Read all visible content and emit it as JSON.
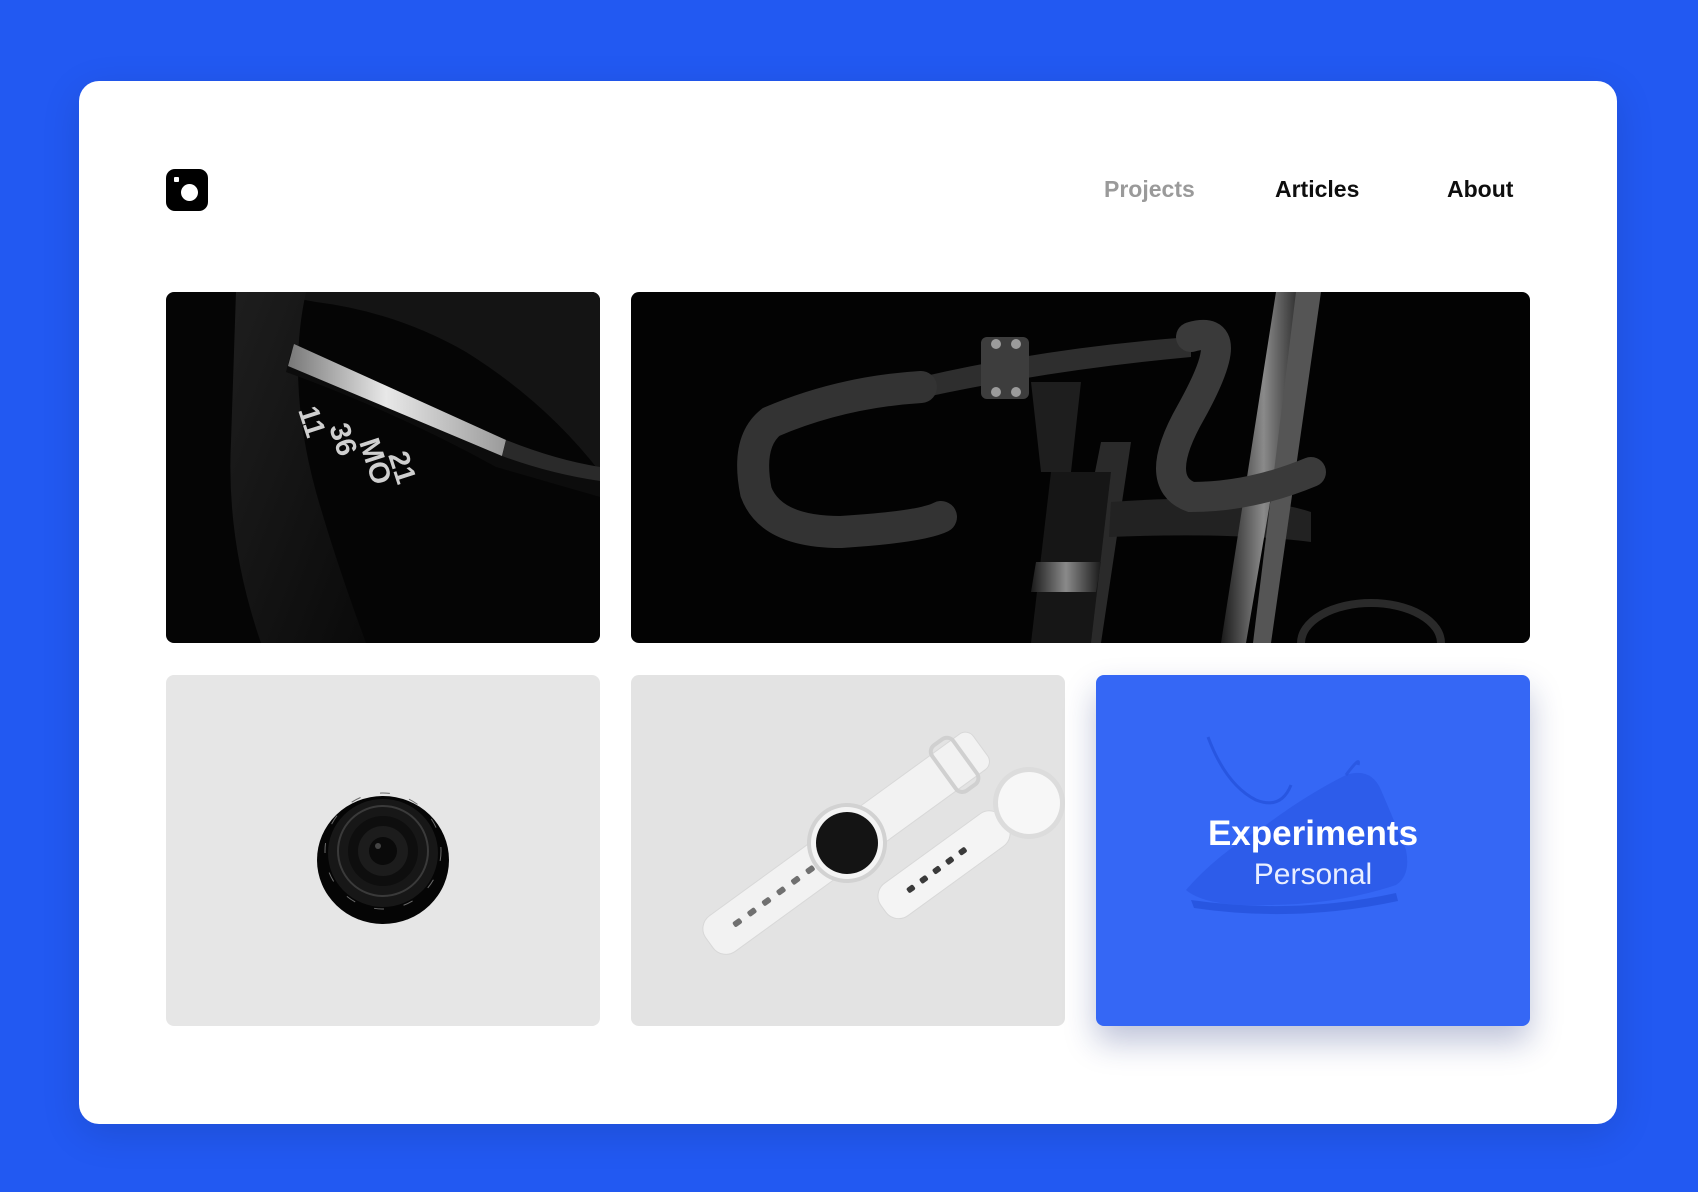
{
  "brand": {
    "logo_icon": "camera-icon"
  },
  "nav": {
    "items": [
      {
        "label": "Projects",
        "state": "muted"
      },
      {
        "label": "Articles",
        "state": "default"
      },
      {
        "label": "About",
        "state": "default"
      }
    ]
  },
  "gallery": {
    "tiles": [
      {
        "name": "fitness-band-photo",
        "icon": "fitness-band-photo"
      },
      {
        "name": "bicycle-handlebar-photo",
        "icon": "bicycle-photo"
      },
      {
        "name": "camera-lens-photo",
        "icon": "camera-lens-photo"
      },
      {
        "name": "white-watches-photo",
        "icon": "watch-photo"
      },
      {
        "name": "experiments-card",
        "title": "Experiments",
        "subtitle": "Personal",
        "icon": "sneaker-icon"
      }
    ],
    "band_display": [
      "11",
      "36",
      "MO",
      "21"
    ]
  },
  "colors": {
    "background": "#2259f2",
    "accent_card": "#3567f5",
    "nav_muted": "#9a9a9a",
    "nav_default": "#0e0e0e"
  }
}
